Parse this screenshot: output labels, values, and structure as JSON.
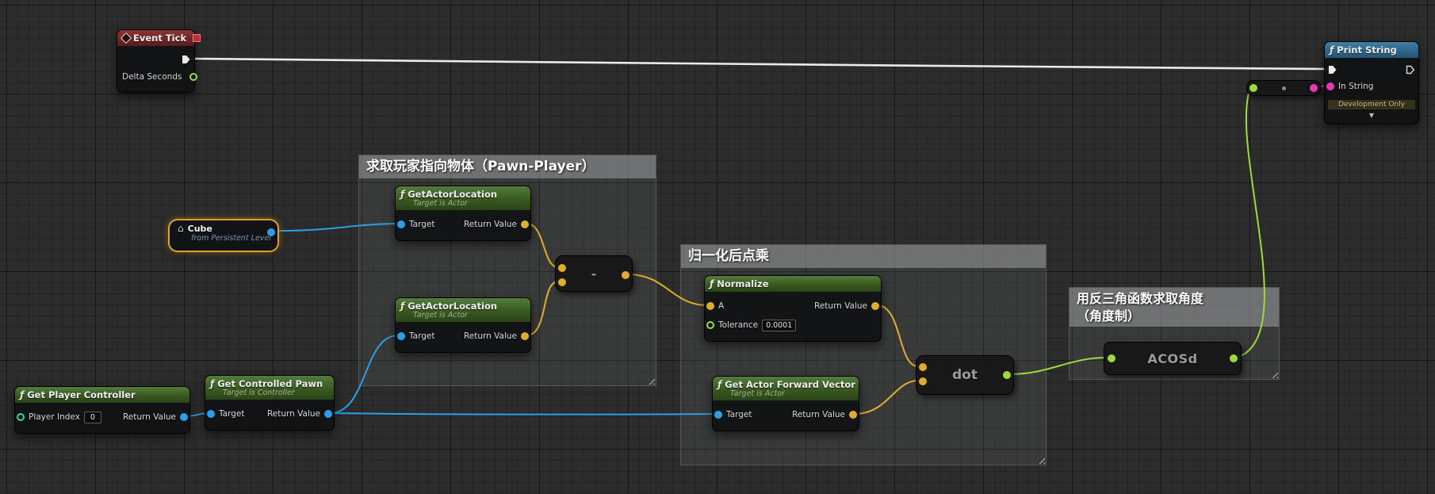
{
  "palette": {
    "exec_wire": "#eaeaea",
    "object_pin": "#2e9fe6",
    "vector_pin": "#dfae2f",
    "float_pin": "#9bdc3c",
    "string_pin": "#e23cb4",
    "int_pin": "#35d6a7",
    "event_header": "#8e3434",
    "function_header": "#547c3e",
    "print_header": "#3f7ea6",
    "selected_outline": "#e0a030"
  },
  "icons": {
    "function": "ƒ",
    "house": "⌂",
    "chevron_down": "▼"
  },
  "comments": {
    "pick_target": "求取玩家指向物体（Pawn-Player）",
    "normalize_dot": "归一化后点乘",
    "acos_line1": "用反三角函数求取角度",
    "acos_line2": "（角度制）"
  },
  "nodes": {
    "event_tick": {
      "title": "Event Tick",
      "delta_seconds_label": "Delta Seconds"
    },
    "print_string": {
      "title": "Print String",
      "in_string_label": "In String",
      "development_only_label": "Development Only"
    },
    "cube": {
      "title": "Cube",
      "subtitle": "from Persistent Level"
    },
    "get_actor_location": {
      "title": "GetActorLocation",
      "subtitle": "Target is Actor",
      "target_label": "Target",
      "return_label": "Return Value"
    },
    "subtract": {
      "label": "-"
    },
    "normalize": {
      "title": "Normalize",
      "a_label": "A",
      "tolerance_label": "Tolerance",
      "tolerance_value": "0.0001",
      "return_label": "Return Value"
    },
    "get_actor_forward_vector": {
      "title": "Get Actor Forward Vector",
      "subtitle": "Target is Actor",
      "target_label": "Target",
      "return_label": "Return Value"
    },
    "dot": {
      "label": "dot"
    },
    "acosd": {
      "label": "ACOSd"
    },
    "get_player_controller": {
      "title": "Get Player Controller",
      "player_index_label": "Player Index",
      "player_index_value": "0",
      "return_label": "Return Value"
    },
    "get_controlled_pawn": {
      "title": "Get Controlled Pawn",
      "subtitle": "Target is Controller",
      "target_label": "Target",
      "return_label": "Return Value"
    }
  }
}
